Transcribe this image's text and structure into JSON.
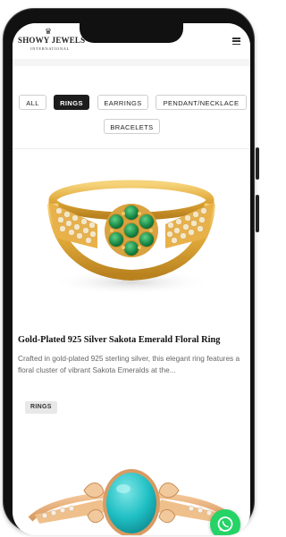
{
  "header": {
    "logo_name": "SHOWY JEWELS",
    "logo_sub": "INTERNATIONAL",
    "menu_icon": "hamburger-icon"
  },
  "filters": [
    {
      "label": "ALL",
      "active": false
    },
    {
      "label": "RINGS",
      "active": true
    },
    {
      "label": "EARRINGS",
      "active": false
    },
    {
      "label": "PENDANT/NECKLACE",
      "active": false
    },
    {
      "label": "BRACELETS",
      "active": false
    }
  ],
  "products": [
    {
      "title": "Gold-Plated 925 Silver Sakota Emerald Floral Ring",
      "description": "Crafted in gold-plated 925 sterling silver, this elegant ring features a floral cluster of vibrant Sakota Emeralds at the...",
      "tag": "RINGS"
    }
  ],
  "colors": {
    "accent": "#1c1c1c",
    "whatsapp": "#25d366"
  },
  "fab_icon": "whatsapp-icon"
}
